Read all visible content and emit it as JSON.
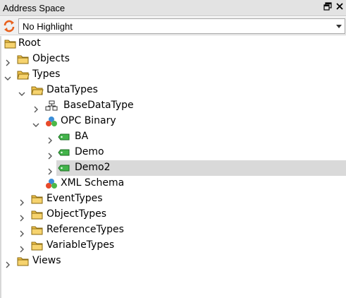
{
  "panel": {
    "title": "Address Space"
  },
  "toolbar": {
    "highlight_value": "No Highlight"
  },
  "tree": {
    "root": "Root",
    "objects": "Objects",
    "types": "Types",
    "datatypes": "DataTypes",
    "basedatatype": "BaseDataType",
    "opc_binary": "OPC Binary",
    "ba": "BA",
    "demo": "Demo",
    "demo2": "Demo2",
    "xml_schema": "XML Schema",
    "eventtypes": "EventTypes",
    "objecttypes": "ObjectTypes",
    "referencetypes": "ReferenceTypes",
    "variabletypes": "VariableTypes",
    "views": "Views"
  },
  "colors": {
    "folder": "#f0c24a",
    "green_tag": "#42b44a",
    "selection": "#d9d9d9"
  }
}
